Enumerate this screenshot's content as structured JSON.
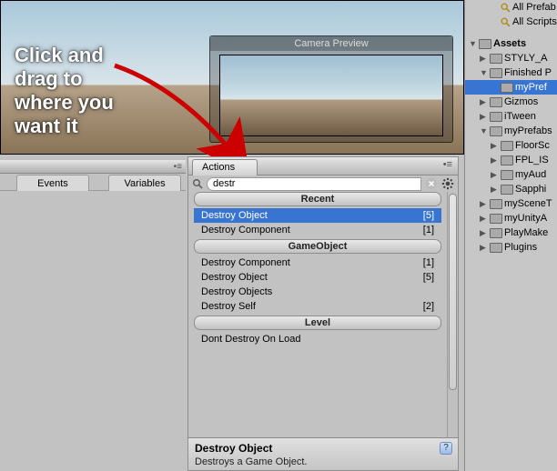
{
  "callout_text": "Click and drag to where you want it",
  "camera_title": "Camera Preview",
  "left_tabs": {
    "events": "Events",
    "variables": "Variables"
  },
  "actions": {
    "tab_label": "Actions",
    "search_value": "destr",
    "groups": [
      {
        "header": "Recent",
        "items": [
          {
            "label": "Destroy Object",
            "count": "[5]",
            "selected": true
          },
          {
            "label": "Destroy Component",
            "count": "[1]",
            "selected": false
          }
        ]
      },
      {
        "header": "GameObject",
        "items": [
          {
            "label": "Destroy Component",
            "count": "[1]",
            "selected": false
          },
          {
            "label": "Destroy Object",
            "count": "[5]",
            "selected": false
          },
          {
            "label": "Destroy Objects",
            "count": "",
            "selected": false
          },
          {
            "label": "Destroy Self",
            "count": "[2]",
            "selected": false
          }
        ]
      },
      {
        "header": "Level",
        "items": [
          {
            "label": "Dont Destroy On Load",
            "count": "",
            "selected": false
          }
        ]
      }
    ],
    "info_title": "Destroy Object",
    "info_desc": "Destroys a Game Object."
  },
  "project": {
    "favorites": [
      "All Prefab",
      "All Scripts"
    ],
    "root_label": "Assets",
    "tree": [
      {
        "indent": 1,
        "tri": "closed",
        "label": "STYLY_A"
      },
      {
        "indent": 1,
        "tri": "open",
        "label": "Finished P"
      },
      {
        "indent": 2,
        "tri": "none",
        "label": "myPref",
        "selected": true
      },
      {
        "indent": 1,
        "tri": "closed",
        "label": "Gizmos"
      },
      {
        "indent": 1,
        "tri": "closed",
        "label": "iTween"
      },
      {
        "indent": 1,
        "tri": "open",
        "label": "myPrefabs"
      },
      {
        "indent": 2,
        "tri": "closed",
        "label": "FloorSc"
      },
      {
        "indent": 2,
        "tri": "closed",
        "label": "FPL_IS"
      },
      {
        "indent": 2,
        "tri": "closed",
        "label": "myAud"
      },
      {
        "indent": 2,
        "tri": "closed",
        "label": "Sapphi"
      },
      {
        "indent": 1,
        "tri": "closed",
        "label": "mySceneT"
      },
      {
        "indent": 1,
        "tri": "closed",
        "label": "myUnityA"
      },
      {
        "indent": 1,
        "tri": "closed",
        "label": "PlayMake"
      },
      {
        "indent": 1,
        "tri": "closed",
        "label": "Plugins"
      }
    ]
  }
}
